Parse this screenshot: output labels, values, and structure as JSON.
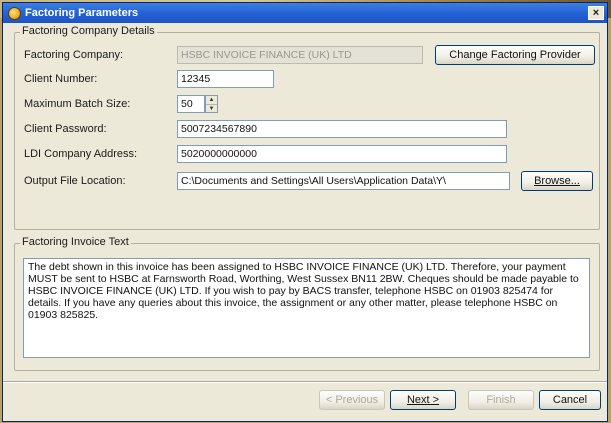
{
  "window": {
    "title": "Factoring Parameters",
    "close_glyph": "×"
  },
  "company_group": {
    "legend": "Factoring Company Details",
    "factoring_company_label": "Factoring Company:",
    "factoring_company_value": "HSBC INVOICE FINANCE (UK) LTD",
    "change_button": "Change Factoring Provider",
    "client_number_label": "Client Number:",
    "client_number_value": "12345",
    "max_batch_label": "Maximum Batch Size:",
    "max_batch_value": "50",
    "client_password_label": "Client Password:",
    "client_password_value": "5007234567890",
    "ldi_label": "LDI Company Address:",
    "ldi_value": "5020000000000",
    "output_label": "Output File Location:",
    "output_value": "C:\\Documents and Settings\\All Users\\Application Data\\Y\\",
    "browse_button": "Browse..."
  },
  "invoice_group": {
    "legend": "Factoring Invoice Text",
    "text": "The debt shown in this invoice has been assigned to HSBC INVOICE FINANCE (UK) LTD. Therefore, your payment MUST be sent to HSBC at Farnsworth Road, Worthing, West Sussex BN11 2BW. Cheques should be made payable to HSBC INVOICE FINANCE (UK) LTD. If you wish to pay by BACS transfer, telephone HSBC on 01903 825474 for details. If you have any queries about this invoice, the assignment or any other matter, please telephone HSBC on 01903 825825."
  },
  "footer": {
    "previous": "< Previous",
    "next": "Next >",
    "finish": "Finish",
    "cancel": "Cancel"
  },
  "icons": {
    "spin_up": "▲",
    "spin_down": "▼"
  },
  "colors": {
    "titlebar": "#2563d6",
    "dialog_bg": "#ece9d8"
  }
}
